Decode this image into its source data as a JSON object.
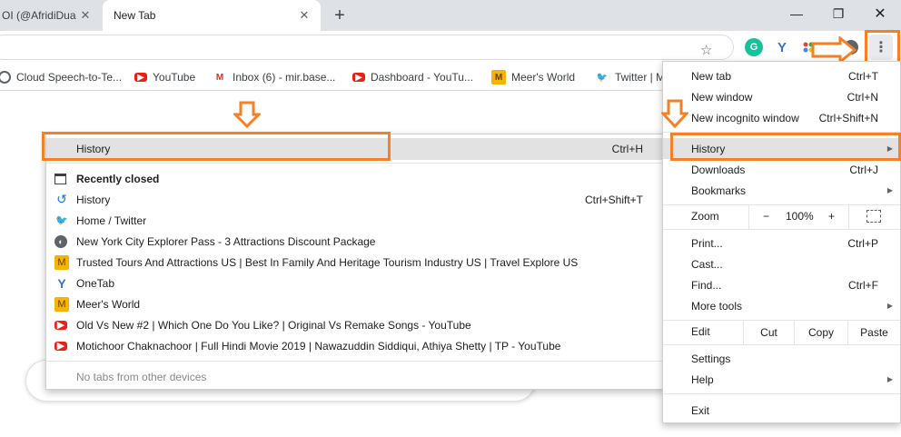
{
  "tabs": [
    {
      "title": "OI (@AfridiDua)",
      "close": "✕"
    },
    {
      "title": "New Tab",
      "close": "✕"
    }
  ],
  "new_tab_symbol": "+",
  "window_controls": {
    "minimize": "—",
    "maximize": "❐",
    "close": "✕"
  },
  "toolbar": {
    "star": "☆",
    "extensions": [
      {
        "icon": "grammarly-icon",
        "glyph": "G"
      },
      {
        "icon": "onetab-icon",
        "glyph": "Y"
      },
      {
        "icon": "extension-icon",
        "glyph": ""
      },
      {
        "icon": "profile-icon",
        "glyph": ""
      }
    ],
    "menu_glyph": "⋮"
  },
  "bookmarks": [
    {
      "label": "Cloud Speech-to-Te...",
      "icon": "cloud-icon",
      "glyph": ""
    },
    {
      "label": "YouTube",
      "icon": "youtube-icon",
      "glyph": "▶"
    },
    {
      "label": "Inbox (6) - mir.base...",
      "icon": "gmail-icon",
      "glyph": "M"
    },
    {
      "label": "Dashboard - YouTu...",
      "icon": "youtube-icon",
      "glyph": "▶"
    },
    {
      "label": "Meer's World",
      "icon": "meers-world-icon",
      "glyph": "M"
    },
    {
      "label": "Twitter | M",
      "icon": "twitter-icon",
      "glyph": "🐦"
    }
  ],
  "history_submenu": {
    "header": {
      "label": "History",
      "shortcut": "Ctrl+H"
    },
    "items": [
      {
        "label": "Recently closed",
        "shortcut": "",
        "icon": "window-icon",
        "glyph": "",
        "bold": true
      },
      {
        "label": "History",
        "shortcut": "Ctrl+Shift+T",
        "icon": "history-clock-icon",
        "glyph": "↺"
      },
      {
        "label": "Home / Twitter",
        "shortcut": "",
        "icon": "twitter-icon",
        "glyph": "🐦"
      },
      {
        "label": "New York City Explorer Pass - 3 Attractions Discount Package",
        "shortcut": "",
        "icon": "globe-icon",
        "glyph": "◐"
      },
      {
        "label": "Trusted Tours And Attractions US | Best In Family And Heritage Tourism Industry US | Travel  Explore US",
        "shortcut": "",
        "icon": "meers-world-icon",
        "glyph": "M"
      },
      {
        "label": "OneTab",
        "shortcut": "",
        "icon": "onetab-icon",
        "glyph": "Y"
      },
      {
        "label": "Meer's World",
        "shortcut": "",
        "icon": "meers-world-icon",
        "glyph": "M"
      },
      {
        "label": "Old Vs New #2 | Which One Do You Like? | Original Vs Remake Songs - YouTube",
        "shortcut": "",
        "icon": "youtube-icon",
        "glyph": "▶"
      },
      {
        "label": "Motichoor Chaknachoor | Full Hindi Movie 2019 | Nawazuddin Siddiqui, Athiya Shetty | TP - YouTube",
        "shortcut": "",
        "icon": "youtube-icon",
        "glyph": "▶"
      }
    ],
    "footer": "No tabs from other devices"
  },
  "main_menu": {
    "group1": [
      {
        "label": "New tab",
        "shortcut": "Ctrl+T"
      },
      {
        "label": "New window",
        "shortcut": "Ctrl+N"
      },
      {
        "label": "New incognito window",
        "shortcut": "Ctrl+Shift+N"
      }
    ],
    "group2": [
      {
        "label": "History",
        "shortcut": "",
        "arrow": "▶"
      },
      {
        "label": "Downloads",
        "shortcut": "Ctrl+J",
        "arrow": ""
      },
      {
        "label": "Bookmarks",
        "shortcut": "",
        "arrow": "▶"
      }
    ],
    "zoom": {
      "label": "Zoom",
      "minus": "−",
      "value": "100%",
      "plus": "+"
    },
    "group3": [
      {
        "label": "Print...",
        "shortcut": "Ctrl+P",
        "arrow": ""
      },
      {
        "label": "Cast...",
        "shortcut": "",
        "arrow": ""
      },
      {
        "label": "Find...",
        "shortcut": "Ctrl+F",
        "arrow": ""
      },
      {
        "label": "More tools",
        "shortcut": "",
        "arrow": "▶"
      }
    ],
    "edit": {
      "label": "Edit",
      "cut": "Cut",
      "copy": "Copy",
      "paste": "Paste"
    },
    "group4": [
      {
        "label": "Settings",
        "shortcut": "",
        "arrow": ""
      },
      {
        "label": "Help",
        "shortcut": "",
        "arrow": "▶"
      }
    ],
    "exit": {
      "label": "Exit"
    }
  },
  "colors": {
    "annotation": "#f58025",
    "hover": "#e2e2e2",
    "tabstrip": "#dee1e6"
  }
}
